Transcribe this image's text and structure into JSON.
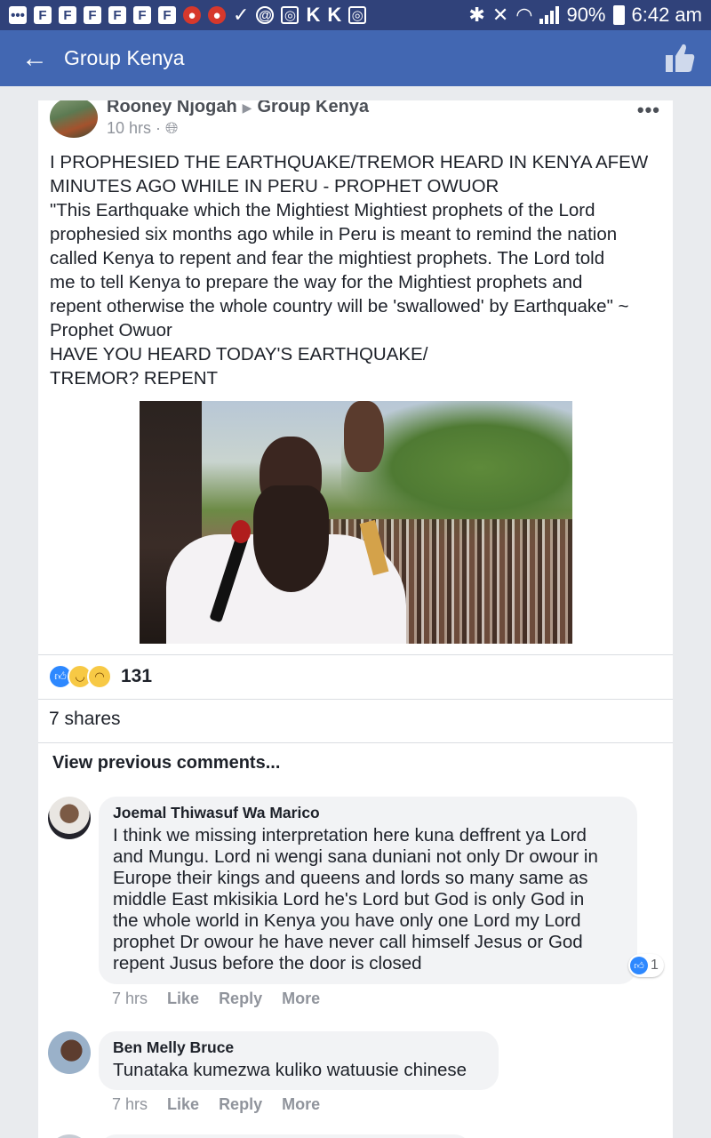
{
  "status_bar": {
    "left_icons": [
      "F",
      "F",
      "F",
      "F",
      "F",
      "F"
    ],
    "k_icons": [
      "K",
      "K"
    ],
    "battery": "90%",
    "time": "6:42 am"
  },
  "app_bar": {
    "title": "Group Kenya"
  },
  "post": {
    "author": "Rooney Njogah",
    "group": "Group Kenya",
    "time": "10 hrs · ",
    "lines": [
      "I PROPHESIED THE EARTHQUAKE/TREMOR HEARD IN KENYA AFEW",
      "MINUTES AGO WHILE IN PERU - PROPHET OWUOR",
      "\"This Earthquake which the Mightiest Mightiest prophets of the Lord",
      "prophesied six months ago while in Peru is meant to remind the nation",
      "called Kenya to repent and fear the mightiest prophets. The Lord told",
      "me to tell Kenya to prepare the way for the Mightiest prophets and",
      "repent otherwise the whole country will be 'swallowed' by Earthquake\" ~",
      "Prophet Owuor",
      "HAVE YOU HEARD TODAY'S EARTHQUAKE/",
      "TREMOR? REPENT"
    ],
    "reaction_count": "131",
    "shares": "7 shares",
    "view_previous": "View previous comments..."
  },
  "comments": [
    {
      "name": "Joemal Thiwasuf Wa Marico",
      "lines": [
        "I think we missing interpretation here kuna deffrent ya Lord",
        "and Mungu. Lord ni wengi sana duniani not only Dr owour in",
        "Europe their kings and queens and lords so many same as",
        "middle East mkisikia Lord he's Lord but God is only God in",
        "the whole world in Kenya you have only one Lord my Lord",
        "prophet Dr owour he have never call himself Jesus or God",
        "repent Jusus before the door is closed"
      ],
      "likes": "1",
      "time": "7 hrs",
      "like": "Like",
      "reply": "Reply",
      "more": "More"
    },
    {
      "name": "Ben Melly Bruce",
      "lines": [
        "Tunataka kumezwa kuliko watuusie chinese"
      ],
      "time": "7 hrs",
      "like": "Like",
      "reply": "Reply",
      "more": "More"
    }
  ],
  "icons": {
    "back": "arrow-left-icon",
    "like_header": "thumbs-up-icon",
    "more": "more-options-icon",
    "globe": "globe-icon"
  },
  "colors": {
    "status_bar": "#30427a",
    "app_bar": "#4267b2",
    "like_blue": "#2d88ff"
  }
}
